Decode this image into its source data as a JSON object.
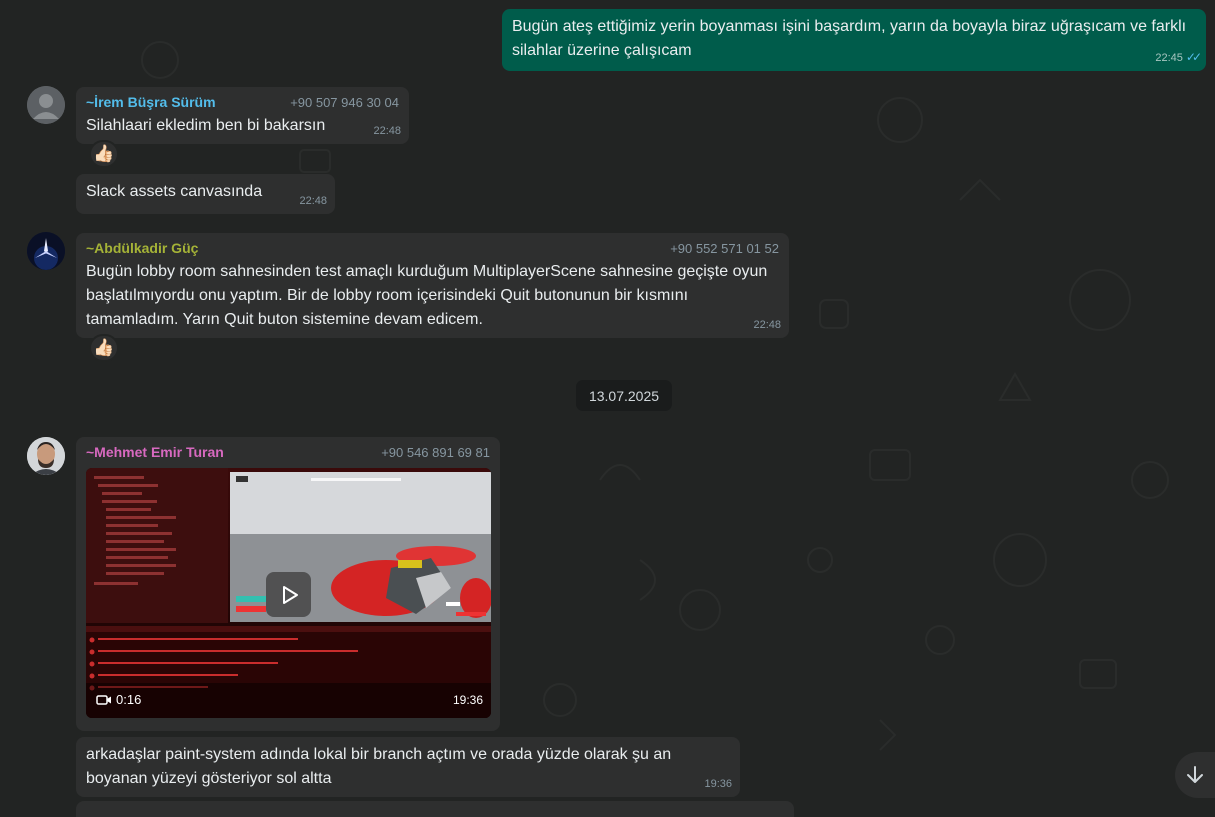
{
  "messages": {
    "m1": {
      "text": "Bugün ateş ettiğimiz yerin boyanması işini başardım, yarın da boyayla biraz uğraşıcam ve farklı silahlar üzerine çalışıcam",
      "time": "22:45"
    },
    "m2": {
      "sender": "~İrem Büşra Sürüm",
      "phone": "+90 507 946 30 04",
      "text": "Silahlaari ekledim ben bi bakarsın",
      "time": "22:48",
      "reaction": "👍🏻"
    },
    "m3": {
      "text": "Slack assets canvasında",
      "time": "22:48"
    },
    "m4": {
      "sender": "~Abdülkadir Güç",
      "phone": "+90 552 571 01 52",
      "text": "Bugün lobby room sahnesinden test amaçlı kurduğum MultiplayerScene sahnesine geçişte oyun başlatılmıyordu onu yaptım. Bir de lobby room içerisindeki Quit butonunun bir kısmını tamamladım. Yarın Quit buton sistemine devam edicem.",
      "time": "22:48",
      "reaction": "👍🏻"
    },
    "date_chip": "13.07.2025",
    "m5": {
      "sender": "~Mehmet Emir Turan",
      "phone": "+90 546 891 69 81",
      "video_duration": "0:16",
      "time": "19:36"
    },
    "m6": {
      "text": "arkadaşlar paint-system adında lokal bir branch açtım ve orada yüzde olarak şu an boyanan yüzeyi gösteriyor sol altta",
      "time": "19:36"
    }
  },
  "colors": {
    "background": "#222423",
    "incoming": "#2e2f2f",
    "outgoing": "#005c4b",
    "sender_irem": "#53bdeb",
    "sender_abdulkadir": "#a5b337",
    "sender_mehmet": "#d869c0"
  },
  "icons": [
    "double-check-icon",
    "thumbs-up-icon",
    "play-icon",
    "video-camera-icon",
    "arrow-down-icon",
    "default-avatar-icon"
  ]
}
